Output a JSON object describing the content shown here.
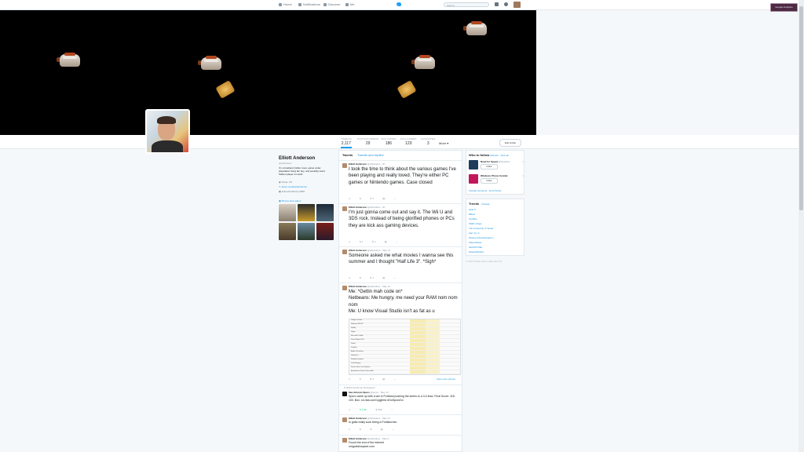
{
  "topbar": {
    "nav": [
      {
        "label": "Home",
        "icon": "home-icon"
      },
      {
        "label": "Notifications",
        "icon": "bell-icon"
      },
      {
        "label": "Discover",
        "icon": "hash-icon"
      },
      {
        "label": "Me",
        "icon": "person-icon"
      }
    ],
    "search_placeholder": "Search",
    "extension_button": "Google Analytics"
  },
  "profile": {
    "name": "Elliott Anderson",
    "handle": "@elliottdevs",
    "bio": "I'm a husband, father, lover, game coder, playstation living fan boy, and possibly worst Tekken player on earth",
    "location": "Texas, US",
    "website": "about.me/elliottanderson",
    "joined": "Joined February 2009",
    "photos_label": "Photos and videos"
  },
  "stats": [
    {
      "label": "TWEETS",
      "value": "2,117"
    },
    {
      "label": "PHOTOS/VIDEOS",
      "value": "29"
    },
    {
      "label": "FOLLOWING",
      "value": "186"
    },
    {
      "label": "FOLLOWERS",
      "value": "129"
    },
    {
      "label": "FAVORITES",
      "value": "3"
    }
  ],
  "more_label": "More ▾",
  "edit_profile": "Edit profile",
  "tabs": [
    "Tweets",
    "Tweets and replies"
  ],
  "tweets": [
    {
      "author": "Elliott Anderson",
      "meta": "@elliottdevs · 2h",
      "text": "I took the time to think about the various games I've been playing and really loved. They're either PC games or Nintendo games. Case closed",
      "size": "big",
      "rt": "",
      "fav": "1"
    },
    {
      "author": "Elliott Anderson",
      "meta": "@elliottdevs · 2h",
      "text": "I'm just gonna come out and say it.  The Wii U and 3DS rock.  Instead of being glorified phones or PCs they are kick ass gaming devices.",
      "size": "big",
      "rt": "1",
      "fav": "1"
    },
    {
      "author": "Elliott Anderson",
      "meta": "@elliottdevs · May 13",
      "text": "Someone asked me what movies I wanna see this summer and I thought \"Half Life 3\". *Sigh*",
      "size": "big",
      "rt": "",
      "fav": "1"
    },
    {
      "author": "Elliott Anderson",
      "meta": "@elliottdevs · May 13",
      "text": "Me: *Gettin mah code on*\nNetbeans: Me hungry, me need your RAM nom nom nom\nMe: U know Visual Studio isn't as fat as u",
      "size": "big",
      "rt": "",
      "fav": "2",
      "view_more": "View more photos"
    },
    {
      "retweeted_by": "Elliott Anderson Retweeted",
      "author": "San Antonio Spurs",
      "meta": "@spurs · May 13",
      "text": "Spurs came up with a win in Portland pushing the series to a 3-0 lead. Final Score: 118-103. Box: on.nba.com/1pgjbmx #GoSpursGo",
      "size": "sm",
      "rt": "1.6K",
      "fav": "839"
    },
    {
      "author": "Elliott Anderson",
      "meta": "@elliottdevs · May 13",
      "text": "Is gotta really suck being a Portland fan.",
      "size": "sm",
      "rt": "",
      "fav": ""
    },
    {
      "author": "Elliott Anderson",
      "meta": "@elliottdevs · May 9",
      "text": "Found the end of the internet omgcatsinspace.com",
      "size": "sm",
      "rt": "",
      "fav": ""
    }
  ],
  "embed_rows": [
    "Google Chrome",
    "Netbeans IDE 8.0",
    "Spotify",
    "Skype",
    "Microsoft Outlook",
    "Visual Studio 2013",
    "Steam",
    "Dropbox",
    "Adobe Photoshop",
    "Notepad++",
    "Windows Explorer",
    "Task Manager",
    "Service Host: Local System",
    "Antimalware Service Executable",
    "Console Window Host",
    "System Idle Process"
  ],
  "who_to_follow": {
    "title": "Who to follow",
    "refresh": "Refresh · View all",
    "items": [
      {
        "name": "Need for Speed",
        "handle": "@NeedFor",
        "follow": "Follow",
        "color": "#1d3d5a"
      },
      {
        "name": "Windows Phone Central",
        "handle": "@wpc",
        "follow": "Follow",
        "color": "#c2185b"
      }
    ],
    "links": "Popular accounts · Find friends"
  },
  "trends": {
    "title": "Trends",
    "change": "· Change",
    "items": [
      "Halo 5",
      "#Boat",
      "Gotdfire",
      "Walk'n Dogs",
      "The University of Texas",
      "Farr Cry 4",
      "#GamersAreHavingFun",
      "#SpursPlast",
      "SlottiSTONE",
      "#Heartbit2014"
    ]
  },
  "footer": "© 2014 Twitter  About  Help  Ads info",
  "colors": {
    "accent": "#1da1f2",
    "link": "#1b95e0",
    "banner": "#000000"
  }
}
